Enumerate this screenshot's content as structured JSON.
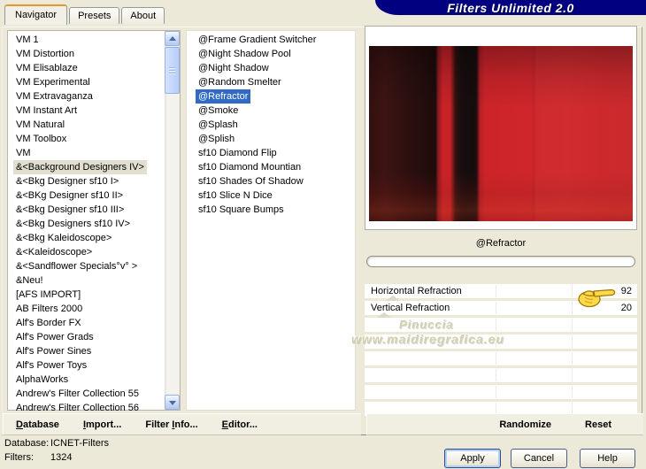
{
  "window": {
    "title": "Filters Unlimited 2.0"
  },
  "tabs": [
    {
      "label": "Navigator"
    },
    {
      "label": "Presets"
    },
    {
      "label": "About"
    }
  ],
  "category_list": {
    "selected": "&<Background Designers IV>",
    "items": [
      "VM 1",
      "VM Distortion",
      "VM Elisablaze",
      "VM Experimental",
      "VM Extravaganza",
      "VM Instant Art",
      "VM Natural",
      "VM Toolbox",
      "VM",
      "&<Background Designers IV>",
      "&<Bkg Designer sf10 I>",
      "&<BKg Designer sf10 II>",
      "&<Bkg Designer sf10 III>",
      "&<Bkg Designers sf10 IV>",
      "&<Bkg Kaleidoscope>",
      "&<Kaleidoscope>",
      "&<Sandflower Specials°v° >",
      "&Neu!",
      "[AFS IMPORT]",
      "AB Filters 2000",
      "Alf's Border FX",
      "Alf's Power Grads",
      "Alf's Power Sines",
      "Alf's Power Toys",
      "AlphaWorks",
      "Andrew's Filter Collection 55",
      "Andrew's Filter Collection 56"
    ]
  },
  "filter_list": {
    "selected": "@Refractor",
    "items": [
      "@Frame Gradient Switcher",
      "@Night Shadow Pool",
      "@Night Shadow",
      "@Random Smelter",
      "@Refractor",
      "@Smoke",
      "@Splash",
      "@Splish",
      "sf10 Diamond Flip",
      "sf10 Diamond Mountian",
      "sf10 Shades Of Shadow",
      "sf10 Slice N Dice",
      "sf10 Square Bumps"
    ]
  },
  "preview": {
    "filter_name": "@Refractor"
  },
  "params": {
    "rows": [
      {
        "label": "Horizontal Refraction",
        "value": 92
      },
      {
        "label": "Vertical Refraction",
        "value": 20
      }
    ],
    "empty_rows": 6
  },
  "watermark": {
    "line1": "Pinuccia",
    "line2": "www.maidiregrafica.eu"
  },
  "toolbar": {
    "buttons": [
      {
        "pre": "",
        "key": "D",
        "post": "atabase"
      },
      {
        "pre": "",
        "key": "I",
        "post": "mport..."
      },
      {
        "pre": "Filter ",
        "key": "I",
        "post": "nfo..."
      },
      {
        "pre": "",
        "key": "E",
        "post": "ditor..."
      }
    ],
    "randomize": "Randomize",
    "reset": "Reset"
  },
  "status": {
    "database_label": "Database:",
    "database_value": "ICNET-Filters",
    "filters_label": "Filters:",
    "filters_value": "1324"
  },
  "action_buttons": {
    "apply": "Apply",
    "cancel": "Cancel",
    "help": "Help"
  },
  "colors": {
    "title_bg": "#010080",
    "selection_blue": "#316ac5",
    "tab_accent_orange": "#e5972d",
    "dialog_bg": "#ece9d8",
    "preview_red": "#cc2428"
  }
}
